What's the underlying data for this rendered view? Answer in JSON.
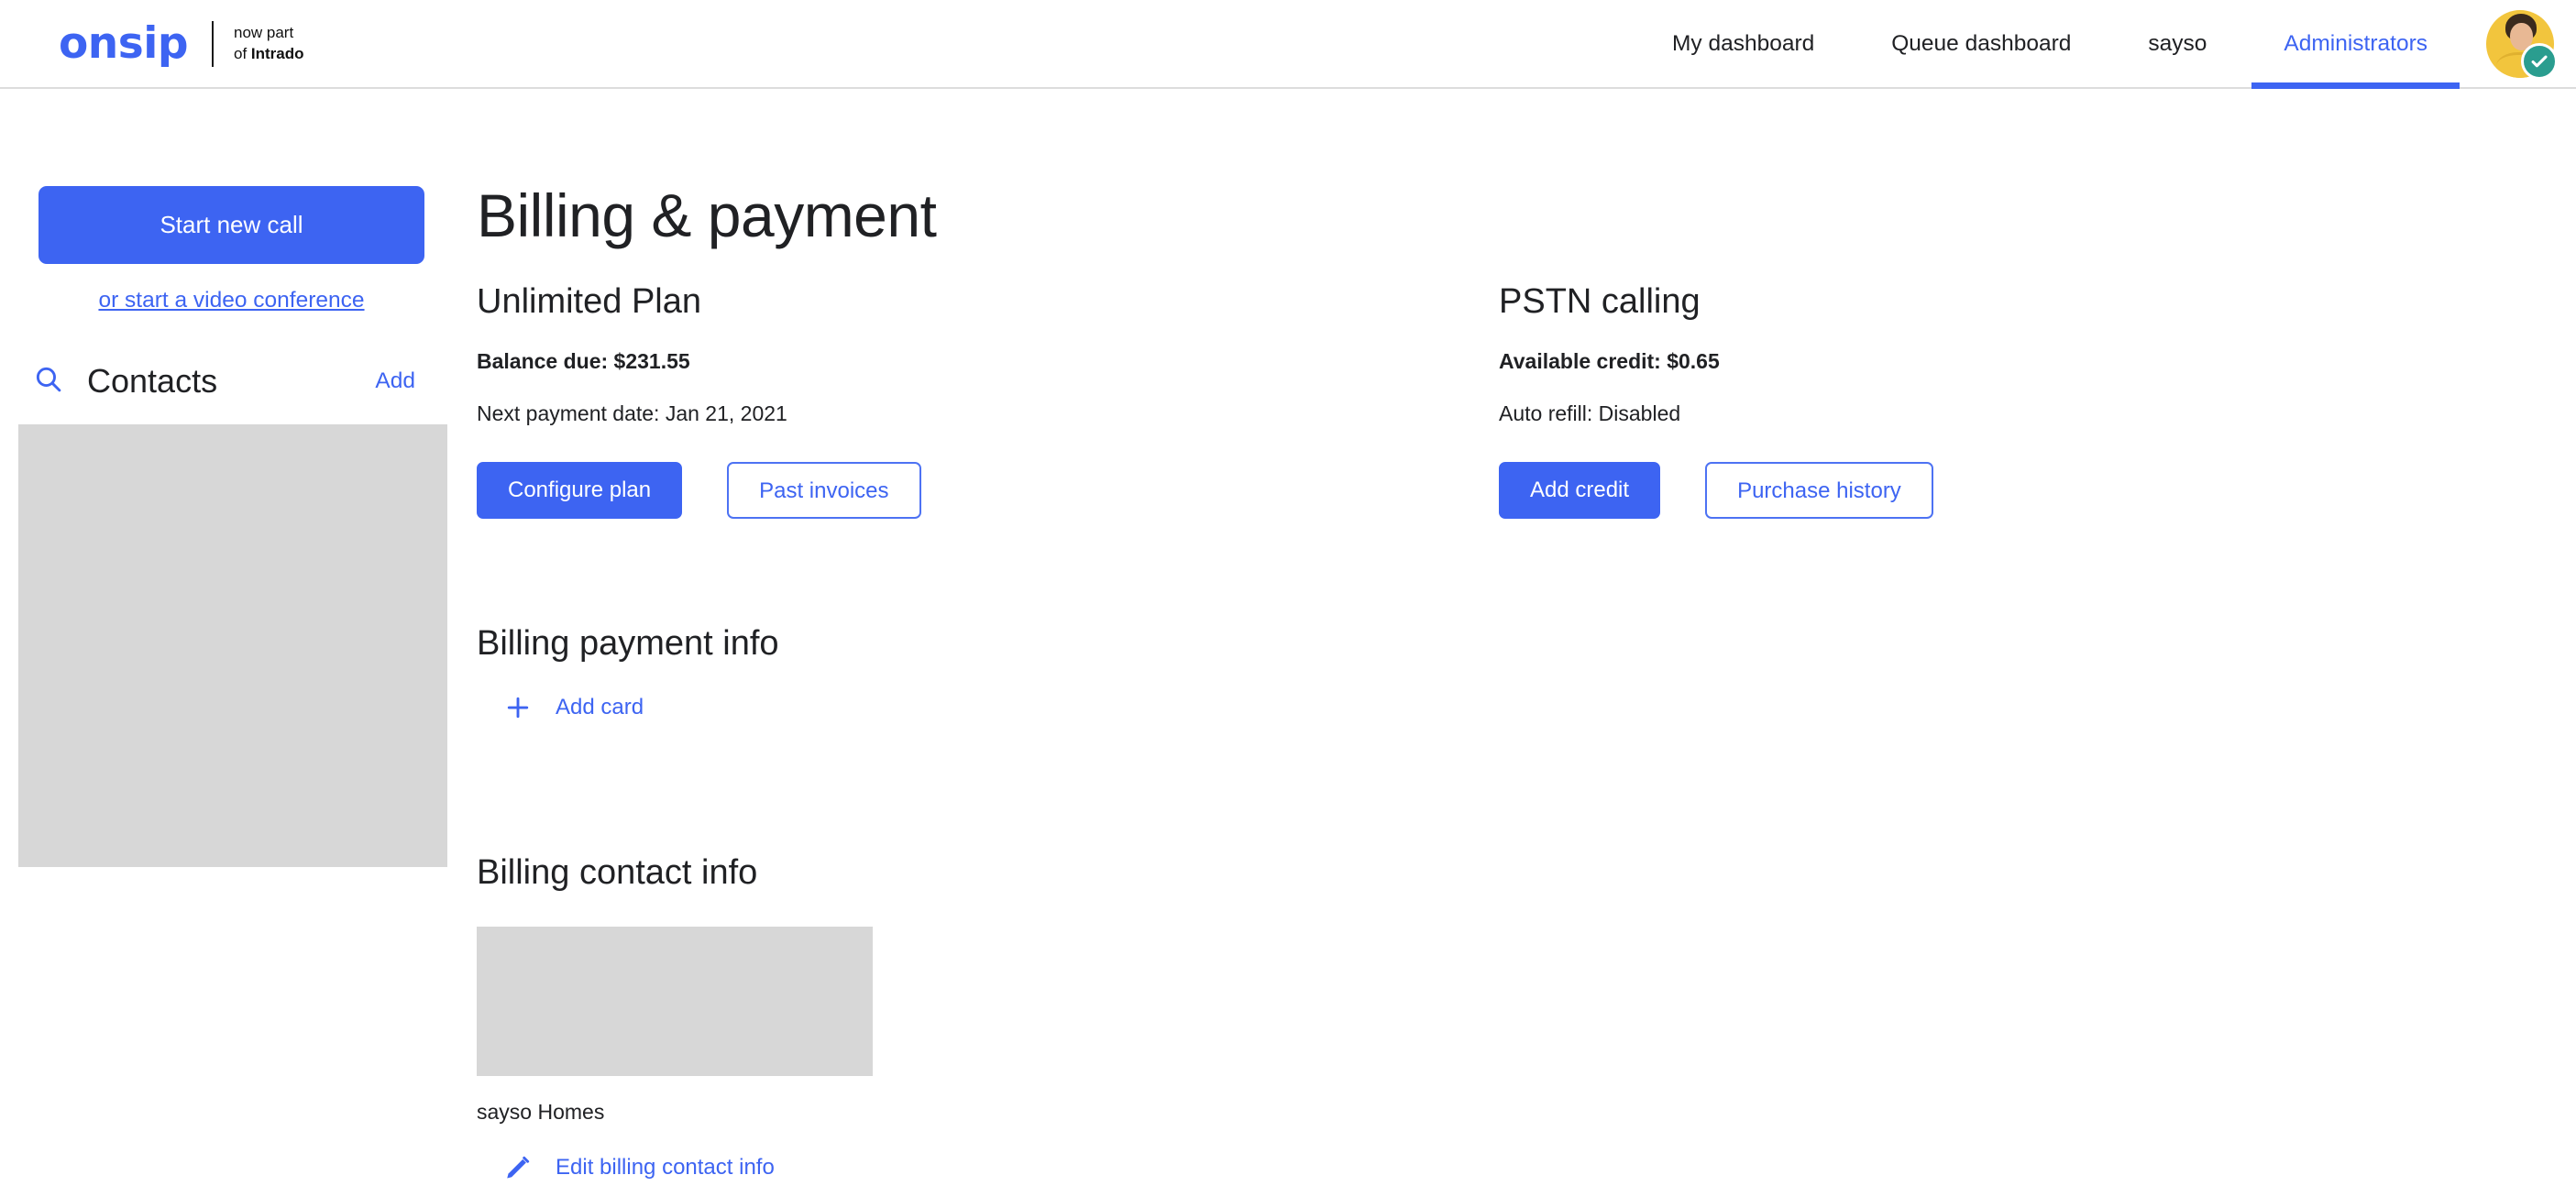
{
  "header": {
    "logo": {
      "wordmark": "onsip",
      "tagline_line1": "now part",
      "tagline_line2_prefix": "of ",
      "tagline_line2_brand": "Intrado"
    },
    "nav": [
      {
        "label": "My dashboard",
        "active": false
      },
      {
        "label": "Queue dashboard",
        "active": false
      },
      {
        "label": "sayso",
        "active": false
      },
      {
        "label": "Administrators",
        "active": true
      }
    ],
    "avatar": {
      "name": "avatar",
      "status_icon": "check-badge-icon"
    }
  },
  "sidebar": {
    "start_call_button": "Start new call",
    "video_conference_link": "or start a video conference",
    "contacts": {
      "search_icon": "search-icon",
      "title": "Contacts",
      "add_label": "Add"
    }
  },
  "main": {
    "page_title": "Billing & payment",
    "plan": {
      "heading": "Unlimited Plan",
      "balance_due": "Balance due: $231.55",
      "next_payment": "Next payment date: Jan 21, 2021",
      "primary_button": "Configure plan",
      "secondary_button": "Past invoices"
    },
    "pstn": {
      "heading": "PSTN calling",
      "available_credit": "Available credit: $0.65",
      "auto_refill": "Auto refill: Disabled",
      "primary_button": "Add credit",
      "secondary_button": "Purchase history"
    },
    "billing_payment_info": {
      "heading": "Billing payment info",
      "add_card_label": "Add card",
      "add_card_icon": "plus-icon"
    },
    "billing_contact_info": {
      "heading": "Billing contact info",
      "contact_name": "sayso Homes",
      "edit_label": "Edit billing contact info",
      "edit_icon": "pencil-icon"
    }
  },
  "colors": {
    "accent_blue": "#3D64F2",
    "placeholder_gray": "#d7d7d7",
    "text_primary": "#202124",
    "badge_green": "#2a9d8f"
  }
}
